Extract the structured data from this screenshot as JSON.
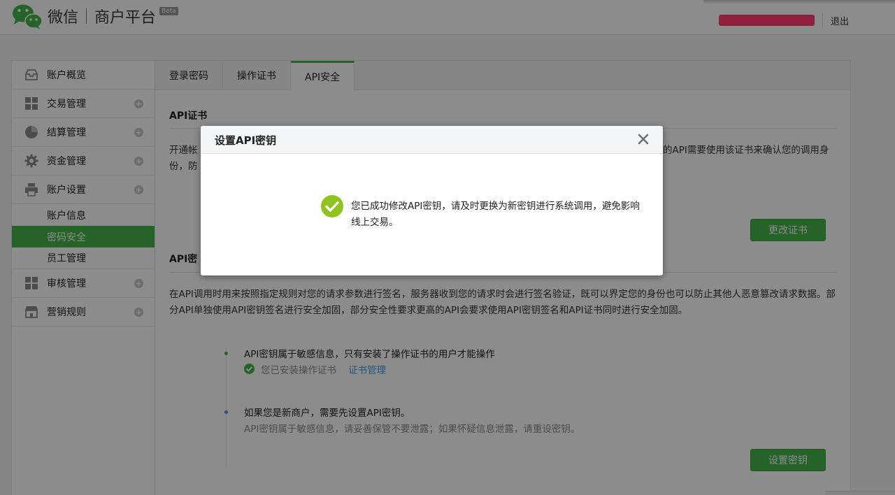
{
  "header": {
    "brand_wechat": "微信",
    "brand_platform": "商户平台",
    "beta": "Beta",
    "logout": "退出"
  },
  "sidebar": {
    "items": [
      {
        "label": "账户概览"
      },
      {
        "label": "交易管理"
      },
      {
        "label": "结算管理"
      },
      {
        "label": "资金管理"
      },
      {
        "label": "账户设置"
      },
      {
        "label": "审核管理"
      },
      {
        "label": "营销规则"
      }
    ],
    "sub_items": [
      {
        "label": "账户信息"
      },
      {
        "label": "密码安全"
      },
      {
        "label": "员工管理"
      }
    ]
  },
  "tabs": [
    {
      "label": "登录密码"
    },
    {
      "label": "操作证书"
    },
    {
      "label": "API安全"
    }
  ],
  "cert_section": {
    "title": "API证书",
    "text_line1": "开通帐",
    "text_line1_right": "的API需要使用该证书来确认您的调用身",
    "text_line2": "份，防",
    "button": "更改证书"
  },
  "key_section": {
    "title": "API密",
    "paragraph": "在API调用时用来按照指定规则对您的请求参数进行签名，服务器收到您的请求时会进行签名验证，既可以界定您的身份也可以防止其他人恶意篡改请求数据。部分API单独使用API密钥签名进行安全加固，部分安全性要求更高的API会要求使用API密钥签名和API证书同时进行安全加固。",
    "step1_text": "API密钥属于敏感信息，只有安装了操作证书的用户才能操作",
    "step1_sub": "您已安装操作证书",
    "step1_link": "证书管理",
    "step2_text": "如果您是新商户，需要先设置API密钥。",
    "step2_sub": "API密钥属于敏感信息，请妥善保管不要泄露；如果怀疑信息泄露，请重设密钥。",
    "button": "设置密钥"
  },
  "dialog": {
    "title": "设置API密钥",
    "message": "您已成功修改API密钥，请及时更换为新密钥进行系统调用，避免影响线上交易。"
  },
  "colors": {
    "accent": "#44b549",
    "link": "#459ae9",
    "user_bar": "#ff3b6f"
  }
}
